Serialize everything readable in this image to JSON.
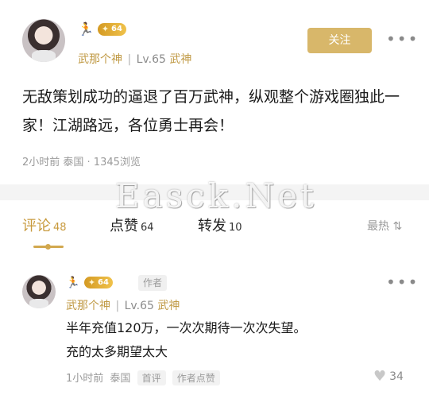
{
  "post": {
    "author": {
      "runner_icon": "runner-icon",
      "badge_level": "64",
      "name": "武那个神",
      "sep": "|",
      "level": "Lv.65",
      "title": "武神"
    },
    "follow_label": "关注",
    "more_icon": "•••",
    "text": "无敌策划成功的逼退了百万武神，纵观整个游戏圈独此一家！江湖路远，各位勇士再会！",
    "meta": "2小时前 泰国 · 1345浏览"
  },
  "watermark": "Easck.Net",
  "tabs": [
    {
      "label": "评论",
      "count": "48"
    },
    {
      "label": "点赞",
      "count": "64"
    },
    {
      "label": "转发",
      "count": "10"
    }
  ],
  "sort": {
    "label": "最热",
    "icon": "⇅"
  },
  "comment": {
    "author": {
      "badge_level": "64",
      "name": "武那个神",
      "sep": "|",
      "level": "Lv.65",
      "title": "武神"
    },
    "author_tag": "作者",
    "more_icon": "•••",
    "text_line1": "半年充值120万，一次次期待一次次失望。",
    "text_line2": "充的太多期望太大",
    "time": "1小时前",
    "location": "泰国",
    "chip_first": "首评",
    "chip_author_like": "作者点赞",
    "like_icon": "♥",
    "like_count": "34"
  },
  "colors": {
    "accent": "#c89a3d",
    "follow_button": "#d8b76a",
    "badge": "#e3ad35"
  }
}
